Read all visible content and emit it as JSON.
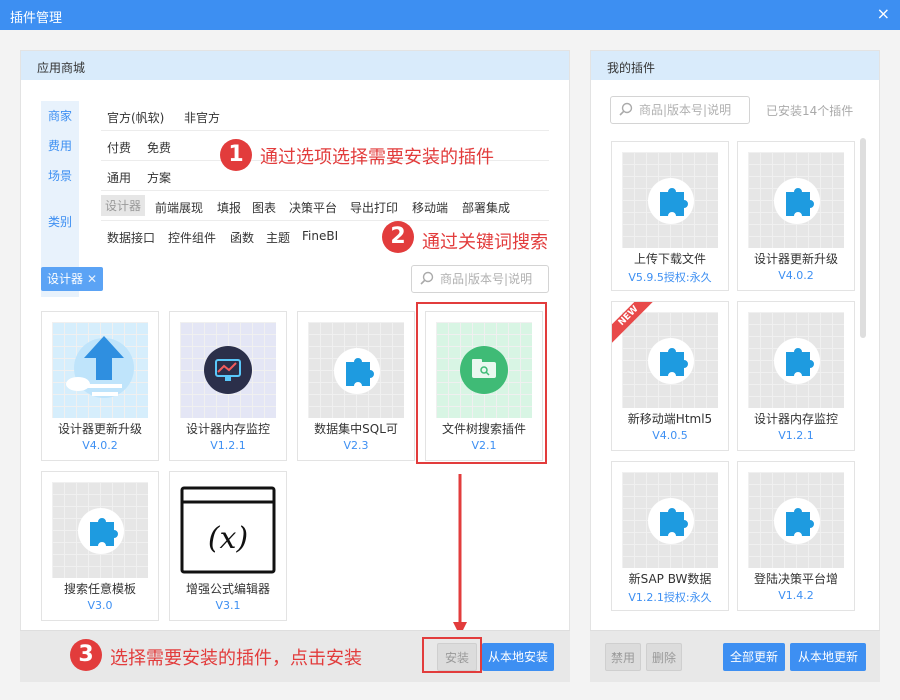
{
  "window": {
    "title": "插件管理",
    "close_glyph": "×"
  },
  "store": {
    "title": "应用商城",
    "filter_tabs": [
      "商家",
      "费用",
      "场景",
      "类别"
    ],
    "filters": {
      "vendor": [
        "官方(帆软)",
        "非官方"
      ],
      "fee": [
        "付费",
        "免费"
      ],
      "scene": [
        "通用",
        "方案"
      ],
      "category_row1": [
        "设计器",
        "前端展现",
        "填报",
        "图表",
        "决策平台",
        "导出打印",
        "移动端",
        "部署集成"
      ],
      "category_row2": [
        "数据接口",
        "控件组件",
        "函数",
        "主题",
        "FineBI"
      ]
    },
    "active_tag": "设计器",
    "active_tag_remove": "✕",
    "search_placeholder": "商品|版本号|说明",
    "cards": [
      {
        "name": "设计器更新升级",
        "version": "V4.0.2",
        "icon": "upload-cloud-icon",
        "color": "#2f8fe0"
      },
      {
        "name": "设计器内存监控",
        "version": "V1.2.1",
        "icon": "memory-monitor-icon",
        "color": "#2b2f4a"
      },
      {
        "name": "数据集中SQL可",
        "version": "V2.3",
        "icon": "puzzle-icon",
        "color": "#1e9be0"
      },
      {
        "name": "文件树搜索插件",
        "version": "V2.1",
        "icon": "folder-search-icon",
        "color": "#3fbb76"
      },
      {
        "name": "搜索任意模板",
        "version": "V3.0",
        "icon": "puzzle-icon",
        "color": "#1e9be0"
      },
      {
        "name": "增强公式编辑器",
        "version": "V3.1",
        "icon": "formula-x-icon",
        "color": "#111111"
      }
    ],
    "install_button": "安装",
    "install_local_button": "从本地安装"
  },
  "annotations": [
    {
      "num": "1",
      "text": "通过选项选择需要安装的插件"
    },
    {
      "num": "2",
      "text": "通过关键词搜索"
    },
    {
      "num": "3",
      "text": "选择需要安装的插件，点击安装"
    }
  ],
  "mine": {
    "title": "我的插件",
    "search_placeholder": "商品|版本号|说明",
    "installed_count": "已安装14个插件",
    "cards": [
      {
        "name": "上传下载文件",
        "version": "V5.9.5授权:永久",
        "icon": "puzzle-icon",
        "new": false
      },
      {
        "name": "设计器更新升级",
        "version": "V4.0.2",
        "icon": "puzzle-icon",
        "new": false
      },
      {
        "name": "新移动端Html5",
        "version": "V4.0.5",
        "icon": "puzzle-icon",
        "new": true,
        "badge": "NEW"
      },
      {
        "name": "设计器内存监控",
        "version": "V1.2.1",
        "icon": "puzzle-icon",
        "new": false
      },
      {
        "name": "新SAP BW数据",
        "version": "V1.2.1授权:永久",
        "icon": "puzzle-icon",
        "new": false
      },
      {
        "name": "登陆决策平台增",
        "version": "V1.4.2",
        "icon": "puzzle-icon",
        "new": false
      }
    ],
    "disable_button": "禁用",
    "delete_button": "删除",
    "update_all_button": "全部更新",
    "update_local_button": "从本地更新"
  },
  "colors": {
    "accent": "#3d8ff2",
    "annotation": "#e23c3c",
    "header": "#d9ebfb"
  }
}
